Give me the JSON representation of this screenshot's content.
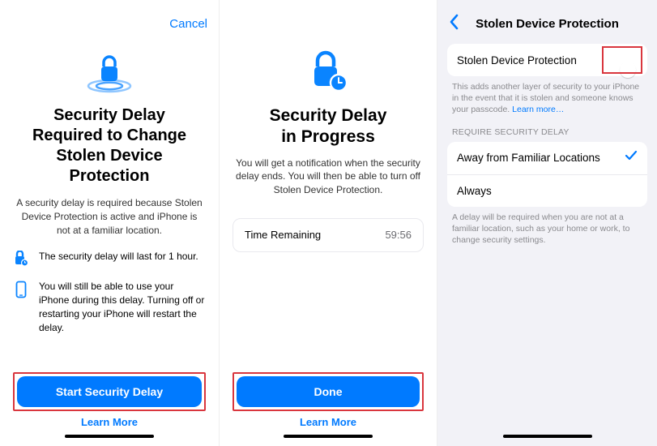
{
  "pane1": {
    "cancel": "Cancel",
    "title": "Security Delay Required to Change Stolen Device Protection",
    "body": "A security delay is required because Stolen Device Protection is active and iPhone is not at a familiar location.",
    "info1": "The security delay will last for 1 hour.",
    "info2": "You will still be able to use your iPhone during this delay. Turning off or restarting your iPhone will restart the delay.",
    "primary": "Start Security Delay",
    "learn": "Learn More"
  },
  "pane2": {
    "title_l1": "Security Delay",
    "title_l2": "in Progress",
    "body": "You will get a notification when the security delay ends. You will then be able to turn off Stolen Device Protection.",
    "time_label": "Time Remaining",
    "time_value": "59:56",
    "primary": "Done",
    "learn": "Learn More"
  },
  "pane3": {
    "nav_title": "Stolen Device Protection",
    "toggle_label": "Stolen Device Protection",
    "helper": "This adds another layer of security to your iPhone in the event that it is stolen and someone knows your passcode.",
    "learn_more": "Learn more…",
    "section": "REQUIRE SECURITY DELAY",
    "opt1": "Away from Familiar Locations",
    "opt2": "Always",
    "footer": "A delay will be required when you are not at a familiar location, such as your home or work, to change security settings."
  }
}
